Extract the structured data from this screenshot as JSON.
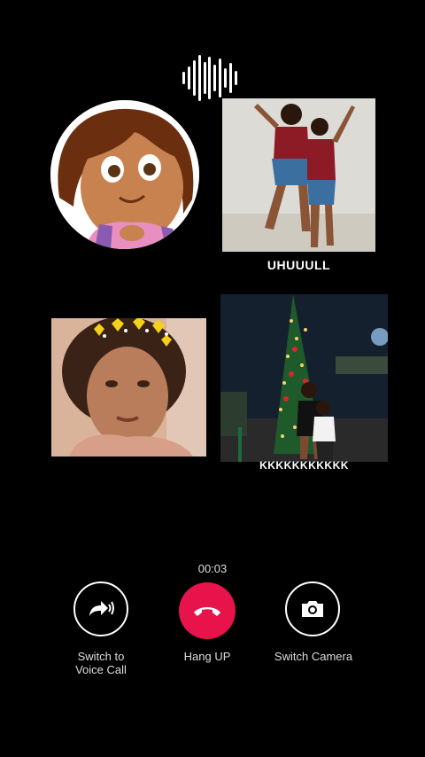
{
  "call": {
    "timer": "00:03"
  },
  "participants": [
    {
      "caption": "UHUUULL"
    },
    {
      "caption": ""
    },
    {
      "caption": "KKKKKKKKKKK"
    }
  ],
  "controls": {
    "voice_label_line1": "Switch to",
    "voice_label_line2": "Voice Call",
    "hangup_label": "Hang UP",
    "camera_label": "Switch Camera"
  },
  "colors": {
    "background": "#000000",
    "hangup": "#e8134a"
  },
  "icons": [
    "sound-wave-icon",
    "forward-arrow-sound-icon",
    "phone-hangup-icon",
    "camera-icon"
  ]
}
